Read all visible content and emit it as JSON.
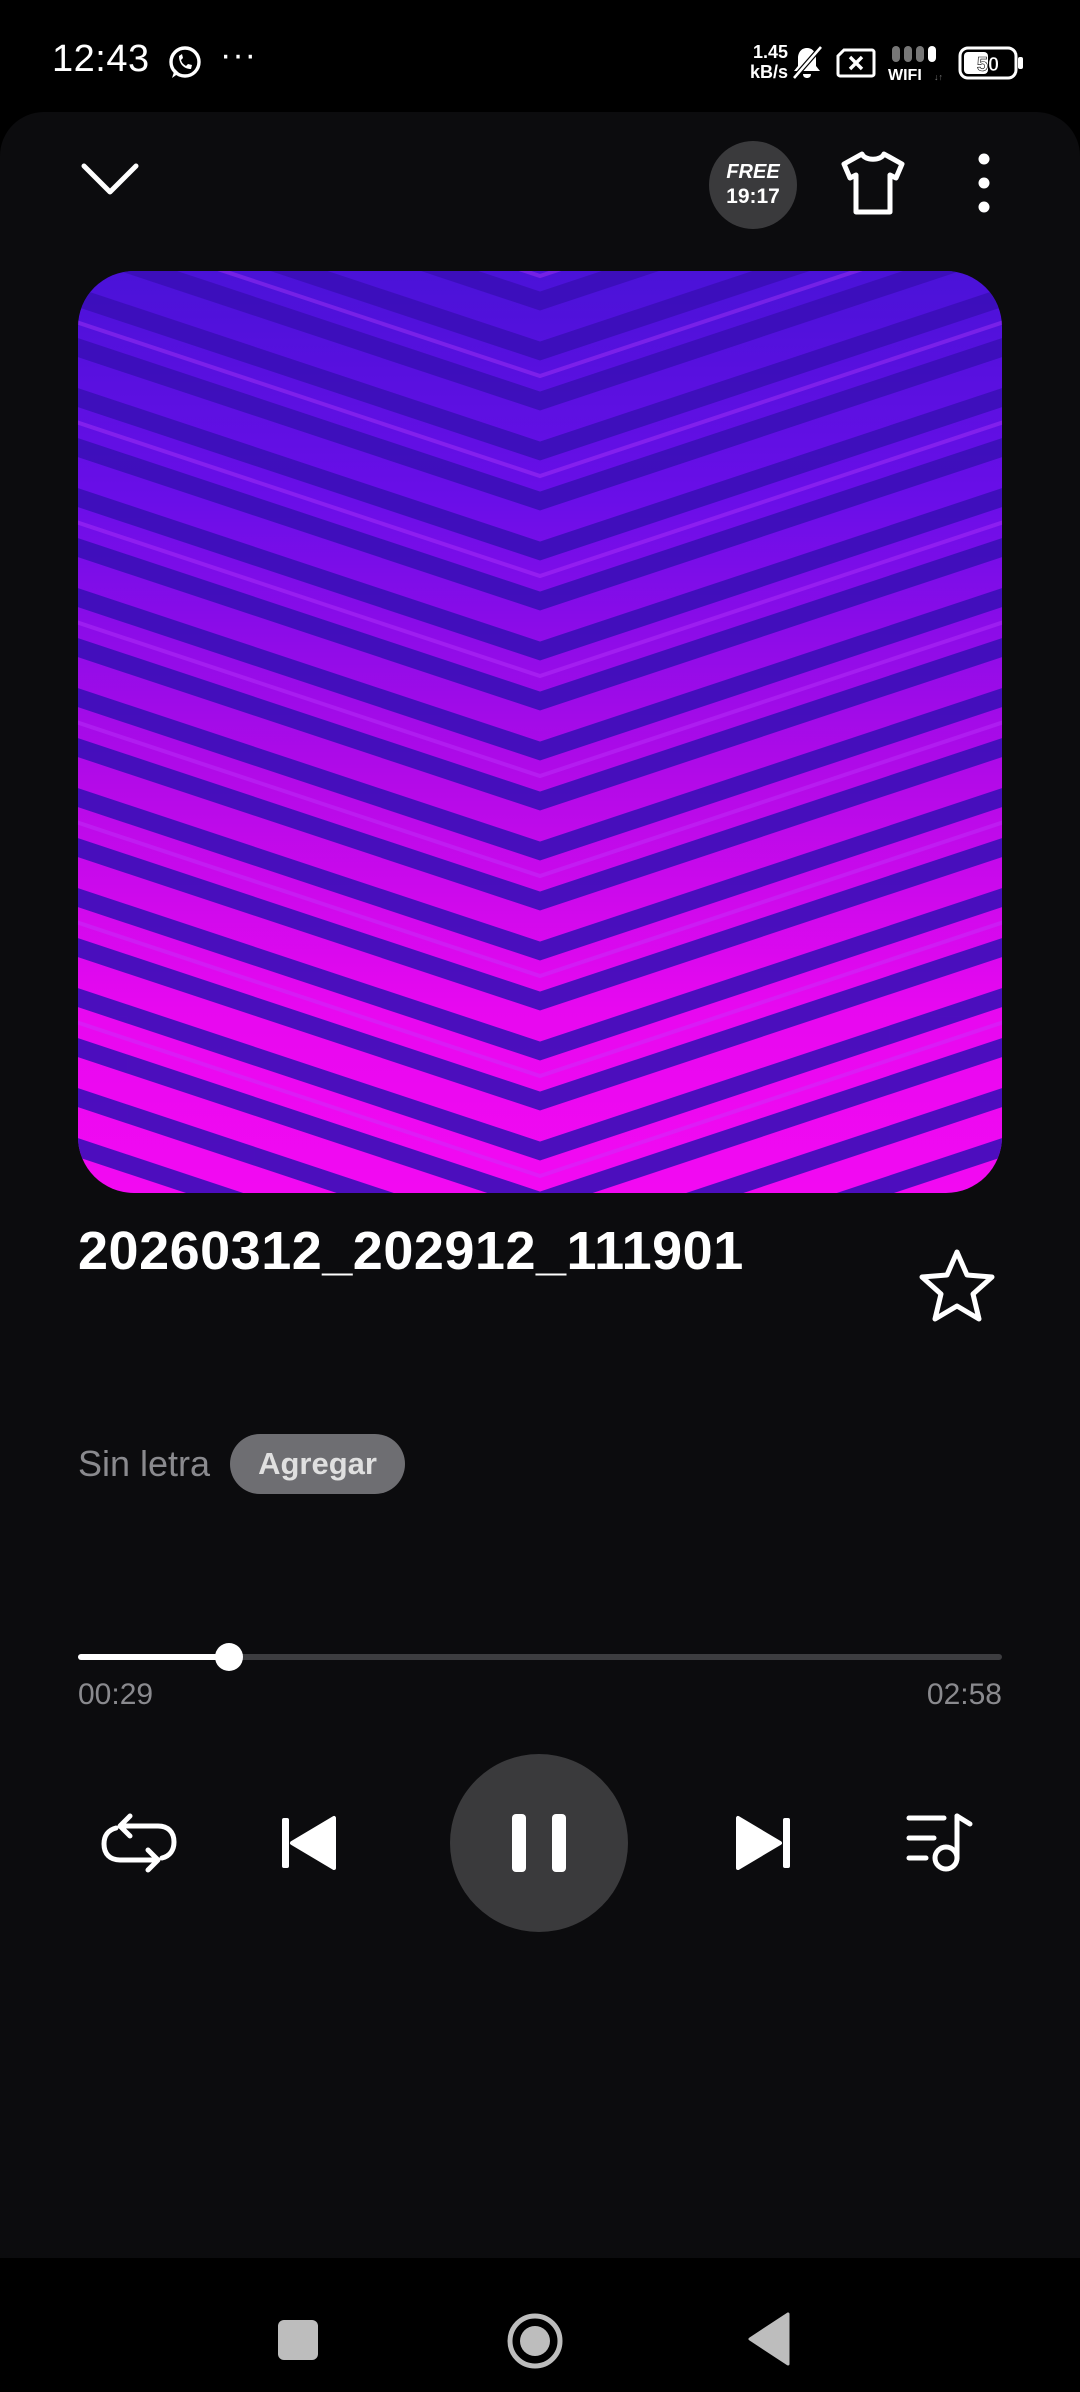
{
  "status_bar": {
    "time": "12:43",
    "more": "···",
    "speed_value": "1.45",
    "speed_unit": "kB/s",
    "wifi_label": "WIFI",
    "battery": "50",
    "icons": [
      "whatsapp-icon",
      "mute-icon",
      "sim-x-icon",
      "signal-icon",
      "battery-icon"
    ]
  },
  "header": {
    "icons": [
      "chevron-down-icon",
      "tshirt-icon",
      "more-vertical-icon"
    ],
    "free_badge": {
      "label": "FREE",
      "time": "19:17"
    }
  },
  "artwork": {
    "colors": {
      "top": "#4a12d8",
      "bottom": "#f209f2",
      "stripe": "#3b0fb8"
    }
  },
  "track": {
    "title": "20260312_202912_111901",
    "favorite_icon": "star-outline-icon"
  },
  "lyrics": {
    "no_lyrics": "Sin letra",
    "add_label": "Agregar"
  },
  "playback": {
    "current_time": "00:29",
    "total_time": "02:58",
    "progress_fraction": 0.163
  },
  "controls": {
    "icons": [
      "repeat-icon",
      "previous-icon",
      "pause-icon",
      "next-icon",
      "queue-icon"
    ]
  },
  "nav": {
    "icons": [
      "recents-icon",
      "home-icon",
      "back-icon"
    ]
  },
  "theme": {
    "background": "#0c0c0e",
    "accent": "#ffffff",
    "muted_text": "#8a8a8e"
  }
}
